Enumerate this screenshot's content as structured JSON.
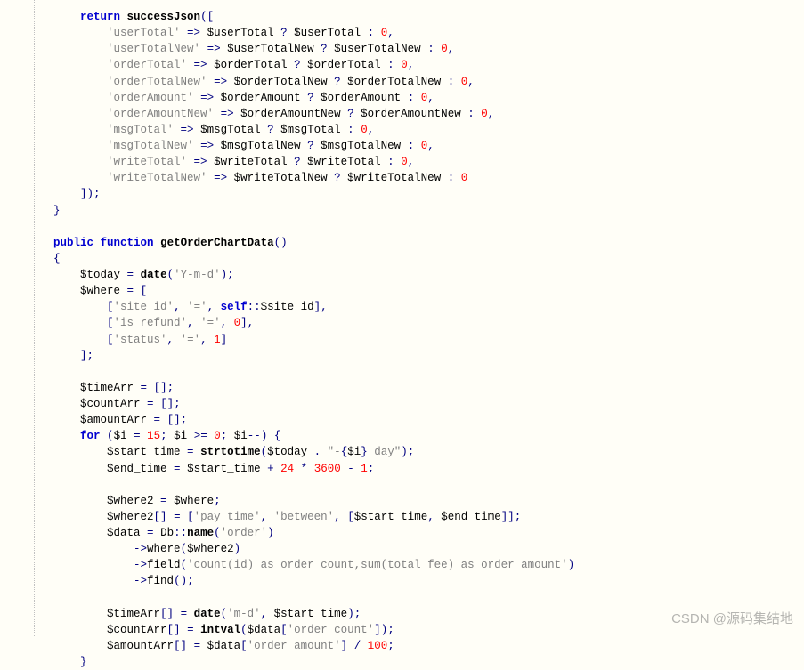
{
  "code": {
    "l1": {
      "kw": "return",
      "fn": "successJson",
      "p1": "(["
    },
    "l2": {
      "s": "'userTotal'",
      "op": "=>",
      "v1": "$userTotal",
      "q": "?",
      "v2": "$userTotal",
      "c": ":",
      "n": "0",
      "e": ","
    },
    "l3": {
      "s": "'userTotalNew'",
      "op": "=>",
      "v1": "$userTotalNew",
      "q": "?",
      "v2": "$userTotalNew",
      "c": ":",
      "n": "0",
      "e": ","
    },
    "l4": {
      "s": "'orderTotal'",
      "op": "=>",
      "v1": "$orderTotal",
      "q": "?",
      "v2": "$orderTotal",
      "c": ":",
      "n": "0",
      "e": ","
    },
    "l5": {
      "s": "'orderTotalNew'",
      "op": "=>",
      "v1": "$orderTotalNew",
      "q": "?",
      "v2": "$orderTotalNew",
      "c": ":",
      "n": "0",
      "e": ","
    },
    "l6": {
      "s": "'orderAmount'",
      "op": "=>",
      "v1": "$orderAmount",
      "q": "?",
      "v2": "$orderAmount",
      "c": ":",
      "n": "0",
      "e": ","
    },
    "l7": {
      "s": "'orderAmountNew'",
      "op": "=>",
      "v1": "$orderAmountNew",
      "q": "?",
      "v2": "$orderAmountNew",
      "c": ":",
      "n": "0",
      "e": ","
    },
    "l8": {
      "s": "'msgTotal'",
      "op": "=>",
      "v1": "$msgTotal",
      "q": "?",
      "v2": "$msgTotal",
      "c": ":",
      "n": "0",
      "e": ","
    },
    "l9": {
      "s": "'msgTotalNew'",
      "op": "=>",
      "v1": "$msgTotalNew",
      "q": "?",
      "v2": "$msgTotalNew",
      "c": ":",
      "n": "0",
      "e": ","
    },
    "l10": {
      "s": "'writeTotal'",
      "op": "=>",
      "v1": "$writeTotal",
      "q": "?",
      "v2": "$writeTotal",
      "c": ":",
      "n": "0",
      "e": ","
    },
    "l11": {
      "s": "'writeTotalNew'",
      "op": "=>",
      "v1": "$writeTotalNew",
      "q": "?",
      "v2": "$writeTotalNew",
      "c": ":",
      "n": "0"
    },
    "l12": {
      "t": "]);"
    },
    "l13": {
      "t": "}"
    },
    "l14": {
      "kw1": "public",
      "kw2": "function",
      "fn": "getOrderChartData",
      "p": "()"
    },
    "l15": {
      "t": "{"
    },
    "l16": {
      "v": "$today",
      "op": "=",
      "fn": "date",
      "p1": "(",
      "s": "'Y-m-d'",
      "p2": ");"
    },
    "l17": {
      "v": "$where",
      "op": "=",
      "p": "["
    },
    "l18": {
      "p1": "[",
      "s1": "'site_id'",
      "c1": ",",
      "s2": "'='",
      "c2": ",",
      "kw": "self",
      "sc": "::",
      "v": "$site_id",
      "p2": "],"
    },
    "l19": {
      "p1": "[",
      "s1": "'is_refund'",
      "c1": ",",
      "s2": "'='",
      "c2": ",",
      "n": "0",
      "p2": "],"
    },
    "l20": {
      "p1": "[",
      "s1": "'status'",
      "c1": ",",
      "s2": "'='",
      "c2": ",",
      "n": "1",
      "p2": "]"
    },
    "l21": {
      "t": "];"
    },
    "l22": {
      "v": "$timeArr",
      "op": "=",
      "p": "[];"
    },
    "l23": {
      "v": "$countArr",
      "op": "=",
      "p": "[];"
    },
    "l24": {
      "v": "$amountArr",
      "op": "=",
      "p": "[];"
    },
    "l25": {
      "kw": "for",
      "p1": "(",
      "v1": "$i",
      "op1": "=",
      "n1": "15",
      "sc1": ";",
      "v2": "$i",
      "op2": ">=",
      "n2": "0",
      "sc2": ";",
      "v3": "$i",
      "op3": "--",
      "p2": ") {"
    },
    "l26": {
      "v1": "$start_time",
      "op": "=",
      "fn": "strtotime",
      "p1": "(",
      "v2": "$today",
      "dot": ".",
      "s1": "\"-",
      "b1": "{",
      "v3": "$i",
      "b2": "}",
      "s2": " day\"",
      "p2": ");"
    },
    "l27": {
      "v1": "$end_time",
      "op": "=",
      "v2": "$start_time",
      "plus": "+",
      "n1": "24",
      "star": "*",
      "n2": "3600",
      "minus": "-",
      "n3": "1",
      "sc": ";"
    },
    "l28": {
      "v1": "$where2",
      "op": "=",
      "v2": "$where",
      "sc": ";"
    },
    "l29": {
      "v1": "$where2",
      "br": "[]",
      "op": "=",
      "p1": "[",
      "s1": "'pay_time'",
      "c1": ",",
      "s2": "'between'",
      "c2": ",",
      "p2": "[",
      "v2": "$start_time",
      "c3": ",",
      "v3": "$end_time",
      "p3": "]];"
    },
    "l30": {
      "v": "$data",
      "op": "=",
      "cl": "Db",
      "sc": "::",
      "fn": "name",
      "p1": "(",
      "s": "'order'",
      "p2": ")"
    },
    "l31": {
      "ar": "->",
      "fn": "where",
      "p1": "(",
      "v": "$where2",
      "p2": ")"
    },
    "l32": {
      "ar": "->",
      "fn": "field",
      "p1": "(",
      "s": "'count(id) as order_count,sum(total_fee) as order_amount'",
      "p2": ")"
    },
    "l33": {
      "ar": "->",
      "fn": "find",
      "p": "();"
    },
    "l34": {
      "v1": "$timeArr",
      "br": "[]",
      "op": "=",
      "fn": "date",
      "p1": "(",
      "s": "'m-d'",
      "c": ",",
      "v2": "$start_time",
      "p2": ");"
    },
    "l35": {
      "v1": "$countArr",
      "br": "[]",
      "op": "=",
      "fn": "intval",
      "p1": "(",
      "v2": "$data",
      "b1": "[",
      "s": "'order_count'",
      "b2": "]);"
    },
    "l36": {
      "v1": "$amountArr",
      "br": "[]",
      "op": "=",
      "v2": "$data",
      "b1": "[",
      "s": "'order_amount'",
      "b2": "]",
      "div": "/",
      "n": "100",
      "sc": ";"
    },
    "l37": {
      "t": "}"
    }
  },
  "watermark": "CSDN @源码集结地"
}
